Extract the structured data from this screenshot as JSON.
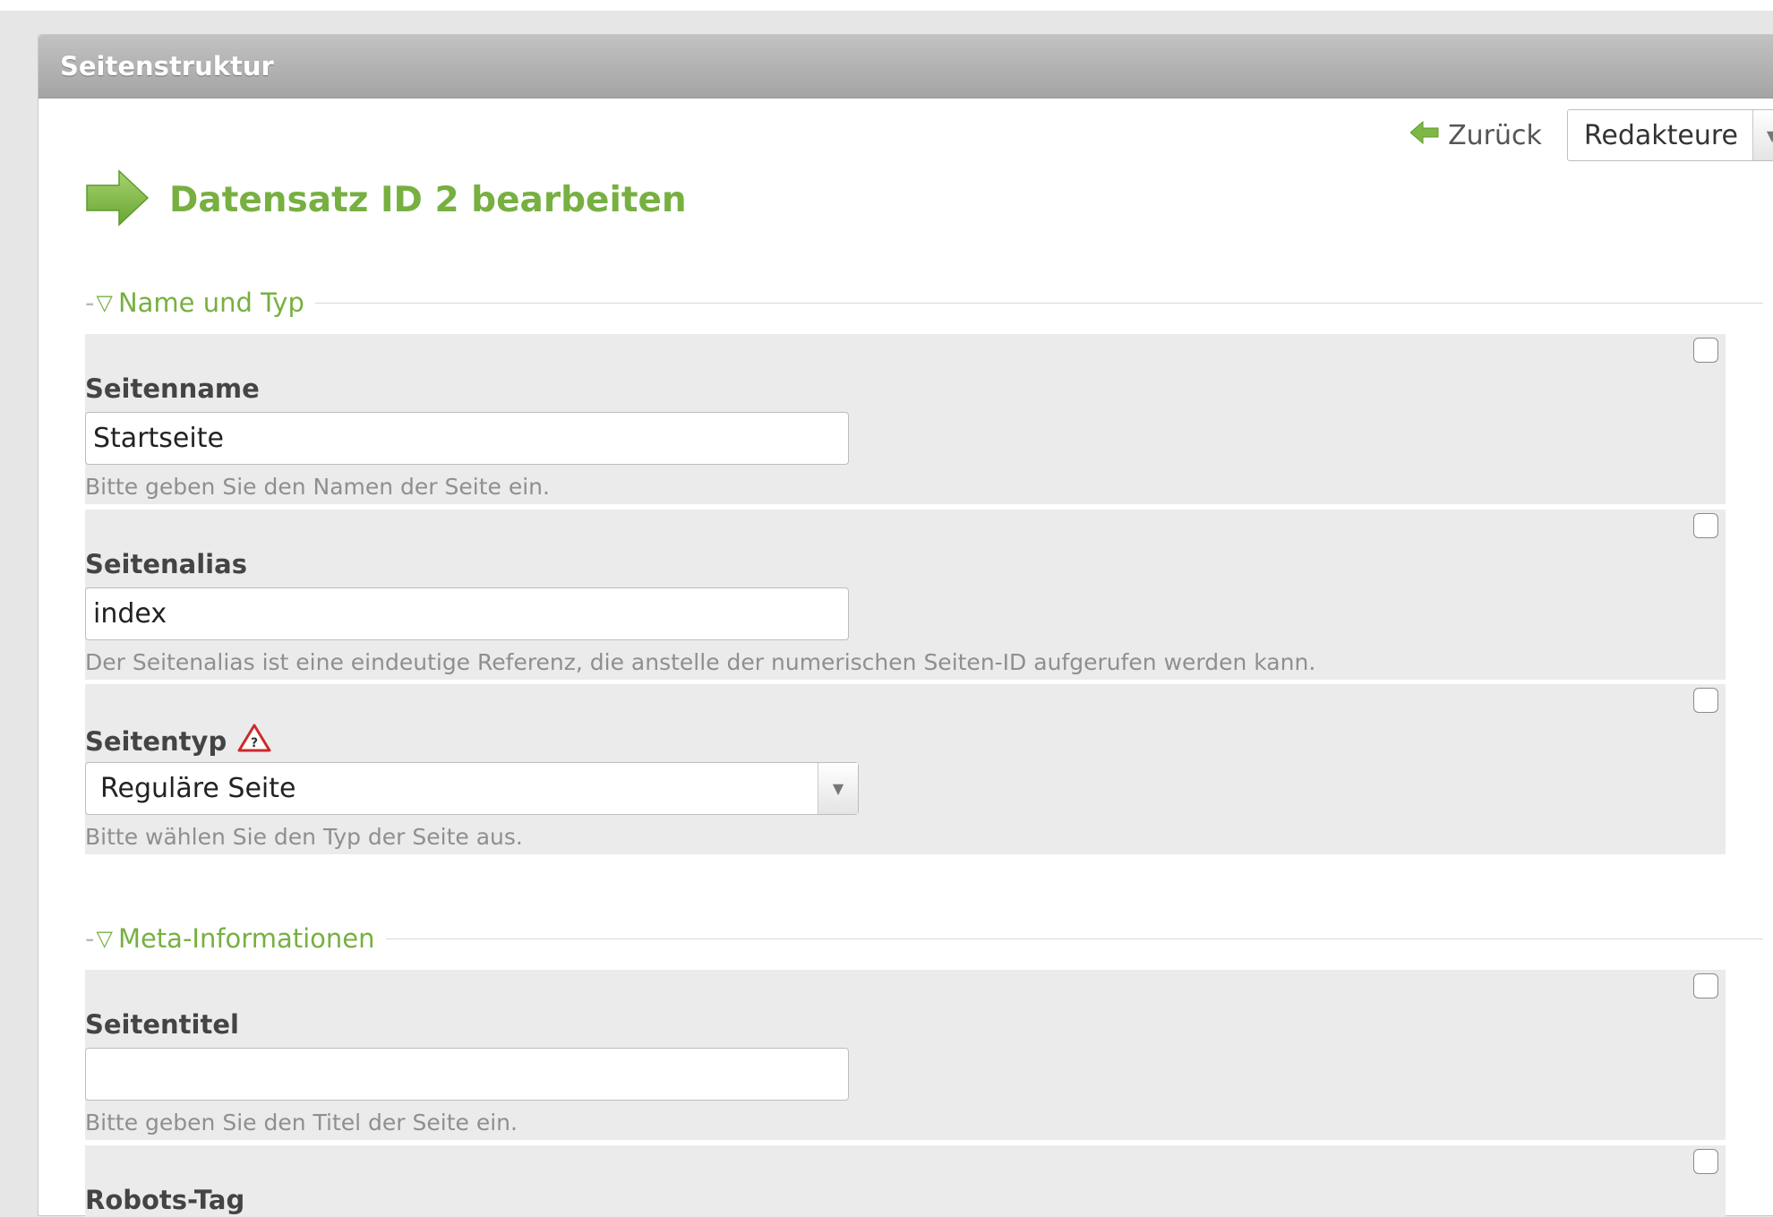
{
  "header": {
    "title": "Seitenstruktur"
  },
  "toolbar": {
    "back_label": "Zurück",
    "back_icon": "arrow-left-icon",
    "group_select_value": "Redakteure"
  },
  "page": {
    "title": "Datensatz ID 2 bearbeiten",
    "title_icon": "arrow-right-icon"
  },
  "colors": {
    "accent": "#77b041",
    "header_bg": "#a9a9a9",
    "row_bg": "#ebebeb",
    "warning": "#cc2a2a"
  },
  "sections": {
    "name_typ": {
      "legend": "Name und Typ",
      "fields": {
        "seitenname": {
          "label": "Seitenname",
          "value": "Startseite",
          "help": "Bitte geben Sie den Namen der Seite ein."
        },
        "seitenalias": {
          "label": "Seitenalias",
          "value": "index",
          "help": "Der Seitenalias ist eine eindeutige Referenz, die anstelle der numerischen Seiten-ID aufgerufen werden kann."
        },
        "seitentyp": {
          "label": "Seitentyp",
          "value": "Reguläre Seite",
          "help": "Bitte wählen Sie den Typ der Seite aus.",
          "icon": "warning-icon"
        }
      }
    },
    "meta": {
      "legend": "Meta-Informationen",
      "fields": {
        "seitentitel": {
          "label": "Seitentitel",
          "value": "",
          "help": "Bitte geben Sie den Titel der Seite ein."
        },
        "robots": {
          "label": "Robots-Tag"
        }
      }
    }
  }
}
